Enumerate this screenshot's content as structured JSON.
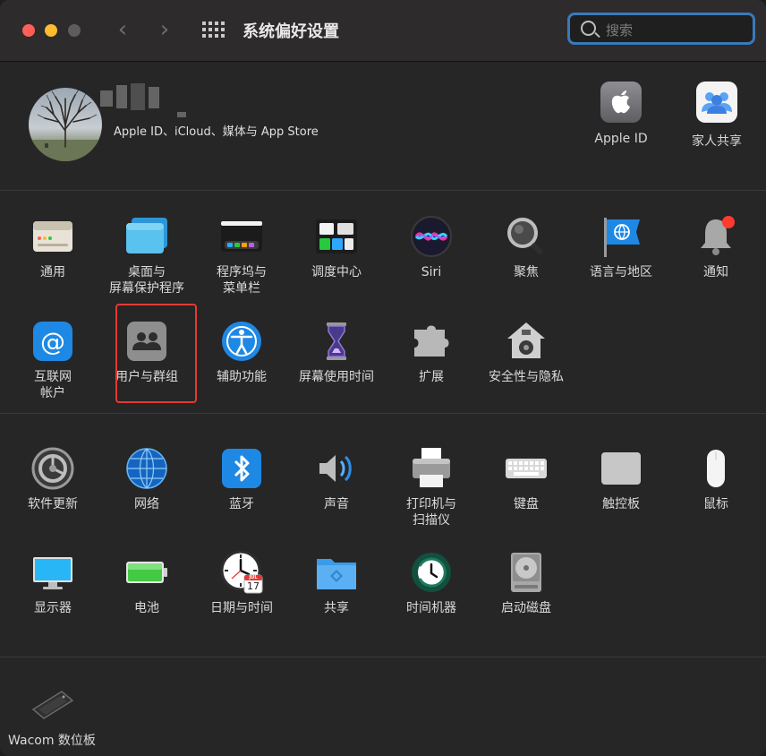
{
  "window": {
    "title": "系统偏好设置"
  },
  "search": {
    "placeholder": "搜索",
    "value": ""
  },
  "account": {
    "subtitle": "Apple ID、iCloud、媒体与 App Store",
    "buttons": [
      {
        "label": "Apple ID",
        "icon": "apple-icon"
      },
      {
        "label": "家人共享",
        "icon": "family-icon"
      }
    ]
  },
  "panes_row1": [
    {
      "label": "通用",
      "icon": "general-icon"
    },
    {
      "label": "桌面与\n屏幕保护程序",
      "icon": "desktop-icon"
    },
    {
      "label": "程序坞与\n菜单栏",
      "icon": "dock-icon"
    },
    {
      "label": "调度中心",
      "icon": "mission-control-icon"
    },
    {
      "label": "Siri",
      "icon": "siri-icon"
    },
    {
      "label": "聚焦",
      "icon": "spotlight-icon"
    },
    {
      "label": "语言与地区",
      "icon": "language-icon"
    },
    {
      "label": "通知",
      "icon": "notification-icon"
    }
  ],
  "panes_row2": [
    {
      "label": "互联网\n帐户",
      "icon": "internet-accounts-icon"
    },
    {
      "label": "用户与群组",
      "icon": "users-groups-icon"
    },
    {
      "label": "辅助功能",
      "icon": "accessibility-icon"
    },
    {
      "label": "屏幕使用时间",
      "icon": "screen-time-icon"
    },
    {
      "label": "扩展",
      "icon": "extensions-icon"
    },
    {
      "label": "安全性与隐私",
      "icon": "security-icon"
    }
  ],
  "panes_row3": [
    {
      "label": "软件更新",
      "icon": "software-update-icon"
    },
    {
      "label": "网络",
      "icon": "network-icon"
    },
    {
      "label": "蓝牙",
      "icon": "bluetooth-icon"
    },
    {
      "label": "声音",
      "icon": "sound-icon"
    },
    {
      "label": "打印机与\n扫描仪",
      "icon": "printer-icon"
    },
    {
      "label": "键盘",
      "icon": "keyboard-icon"
    },
    {
      "label": "触控板",
      "icon": "trackpad-icon"
    },
    {
      "label": "鼠标",
      "icon": "mouse-icon"
    }
  ],
  "panes_row4": [
    {
      "label": "显示器",
      "icon": "display-icon"
    },
    {
      "label": "电池",
      "icon": "battery-icon"
    },
    {
      "label": "日期与时间",
      "icon": "clock-icon",
      "date_badge_month": "JUL",
      "date_badge_day": "17"
    },
    {
      "label": "共享",
      "icon": "sharing-icon"
    },
    {
      "label": "时间机器",
      "icon": "time-machine-icon"
    },
    {
      "label": "启动磁盘",
      "icon": "startup-disk-icon"
    }
  ],
  "panes_other": [
    {
      "label": "Wacom 数位板",
      "icon": "wacom-tablet-icon"
    }
  ]
}
